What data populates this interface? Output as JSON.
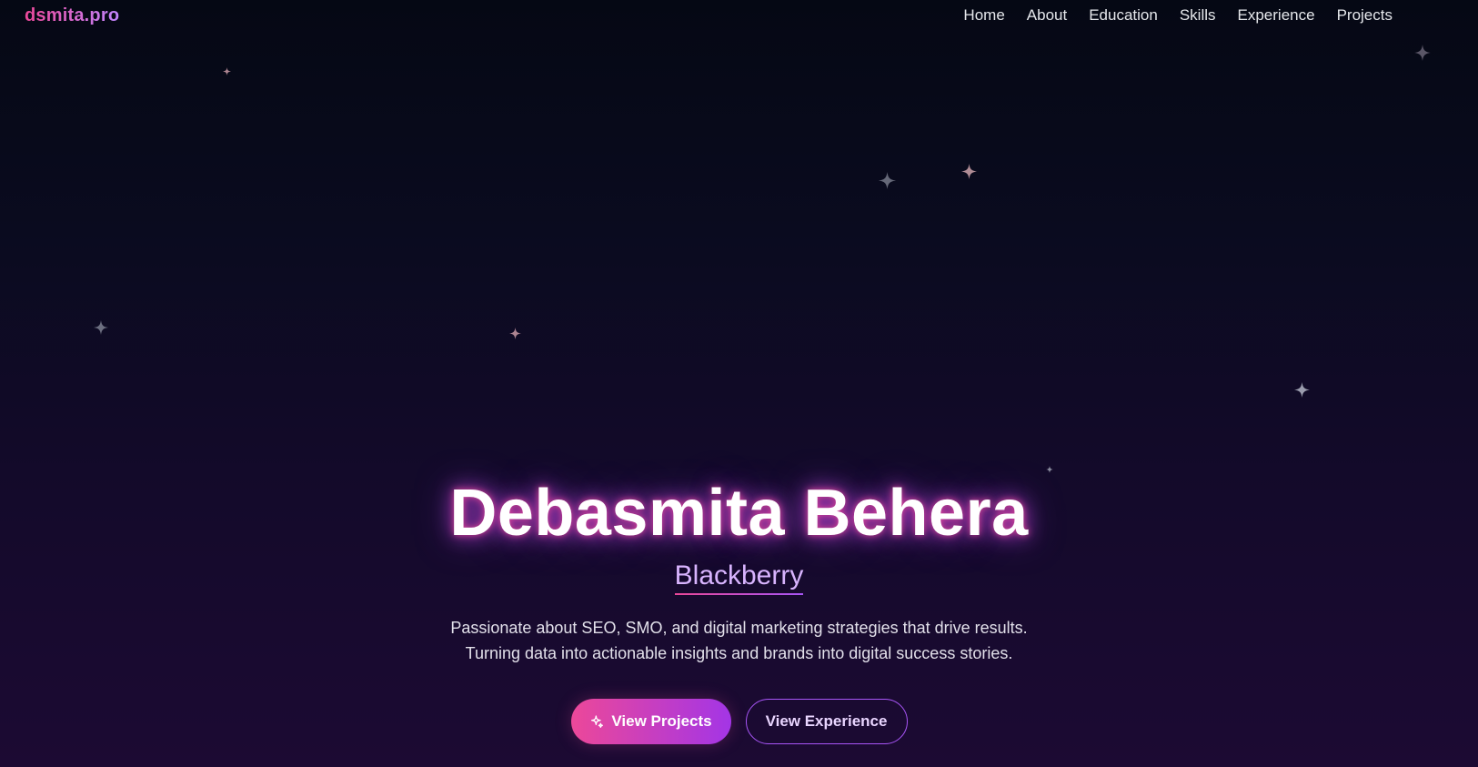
{
  "header": {
    "logo_main": "dsmita",
    "logo_ext": ".pro",
    "nav": [
      {
        "label": "Home"
      },
      {
        "label": "About"
      },
      {
        "label": "Education"
      },
      {
        "label": "Skills"
      },
      {
        "label": "Experience"
      },
      {
        "label": "Projects"
      }
    ]
  },
  "hero": {
    "name": "Debasmita Behera",
    "role": "Blackberry",
    "description_line1": "Passionate about SEO, SMO, and digital marketing strategies that drive results.",
    "description_line2": "Turning data into actionable insights and brands into digital success stories.",
    "primary_button": {
      "label": "View Projects",
      "icon": "sparkles-icon"
    },
    "secondary_button": {
      "label": "View Experience"
    }
  },
  "colors": {
    "accent_pink": "#ec4899",
    "accent_purple": "#a855f7",
    "background_top": "#050814",
    "background_bottom": "#1c0a33"
  },
  "decorations": {
    "icon": "four-point-star-icon"
  }
}
